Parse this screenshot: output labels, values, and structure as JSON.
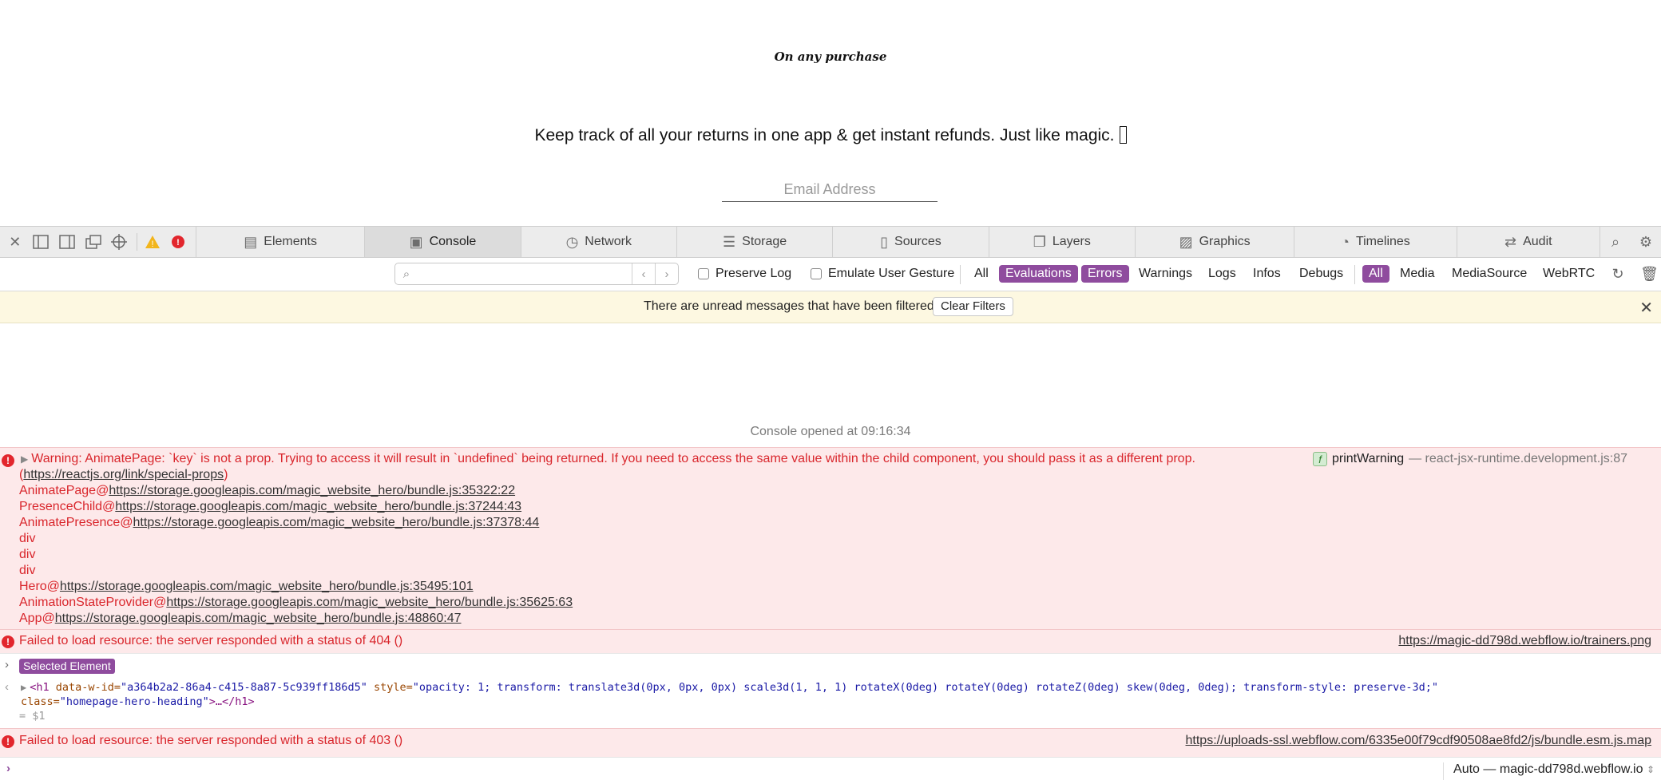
{
  "page": {
    "tagline": "On any purchase",
    "hero_text": "Keep track of all your returns in one app & get instant refunds. Just like magic.",
    "email_placeholder": "Email Address"
  },
  "devtools": {
    "tabs": [
      {
        "label": "Elements",
        "icon": "elements-icon"
      },
      {
        "label": "Console",
        "icon": "console-icon",
        "active": true
      },
      {
        "label": "Network",
        "icon": "network-icon"
      },
      {
        "label": "Storage",
        "icon": "storage-icon"
      },
      {
        "label": "Sources",
        "icon": "sources-icon"
      },
      {
        "label": "Layers",
        "icon": "layers-icon"
      },
      {
        "label": "Graphics",
        "icon": "graphics-icon"
      },
      {
        "label": "Timelines",
        "icon": "timelines-icon"
      },
      {
        "label": "Audit",
        "icon": "audit-icon"
      }
    ],
    "filter": {
      "preserve_log": "Preserve Log",
      "emulate_gesture": "Emulate User Gesture",
      "levels": [
        "All",
        "Evaluations",
        "Errors",
        "Warnings",
        "Logs",
        "Infos",
        "Debugs"
      ],
      "sources": [
        "All",
        "Media",
        "MediaSource",
        "WebRTC"
      ]
    },
    "notice": {
      "text": "There are unread messages that have been filtered",
      "button": "Clear Filters"
    },
    "console": {
      "opened": "Console opened at 09:16:34",
      "warning": {
        "message": "Warning: AnimatePage: `key` is not a prop. Trying to access it will result in `undefined` being returned. If you need to access the same value within the child component, you should pass it as a different prop.",
        "link_open": "(",
        "link": "https://reactjs.org/link/special-props",
        "link_close": ")",
        "function": "printWarning",
        "location": "— react-jsx-runtime.development.js:87",
        "stack": [
          {
            "name": "AnimatePage@",
            "url": "https://storage.googleapis.com/magic_website_hero/bundle.js:35322:22"
          },
          {
            "name": "PresenceChild@",
            "url": "https://storage.googleapis.com/magic_website_hero/bundle.js:37244:43"
          },
          {
            "name": "AnimatePresence@",
            "url": "https://storage.googleapis.com/magic_website_hero/bundle.js:37378:44"
          },
          {
            "name": "div",
            "url": ""
          },
          {
            "name": "div",
            "url": ""
          },
          {
            "name": "div",
            "url": ""
          },
          {
            "name": "Hero@",
            "url": "https://storage.googleapis.com/magic_website_hero/bundle.js:35495:101"
          },
          {
            "name": "AnimationStateProvider@",
            "url": "https://storage.googleapis.com/magic_website_hero/bundle.js:35625:63"
          },
          {
            "name": "App@",
            "url": "https://storage.googleapis.com/magic_website_hero/bundle.js:48860:47"
          }
        ]
      },
      "error404": {
        "message": "Failed to load resource: the server responded with a status of 404 ()",
        "url": "https://magic-dd798d.webflow.io/trainers.png"
      },
      "selected_badge": "Selected Element",
      "element_code": {
        "tag_open": "<h1",
        "attr1": " data-w-id=",
        "val1": "\"a364b2a2-86a4-c415-8a87-5c939ff186d5\"",
        "attr2": " style=",
        "val2": "\"opacity: 1; transform: translate3d(0px, 0px, 0px) scale3d(1, 1, 1) rotateX(0deg) rotateY(0deg) rotateZ(0deg) skew(0deg, 0deg); transform-style: preserve-3d;\"",
        "attr3": "class=",
        "val3": "\"homepage-hero-heading\"",
        "tag_close": ">…</h1>",
        "result": "= $1"
      },
      "error403": {
        "message": "Failed to load resource: the server responded with a status of 403 ()",
        "url": "https://uploads-ssl.webflow.com/6335e00f79cdf90508ae8fd2/js/bundle.esm.js.map"
      },
      "context": "Auto — magic-dd798d.webflow.io"
    }
  }
}
